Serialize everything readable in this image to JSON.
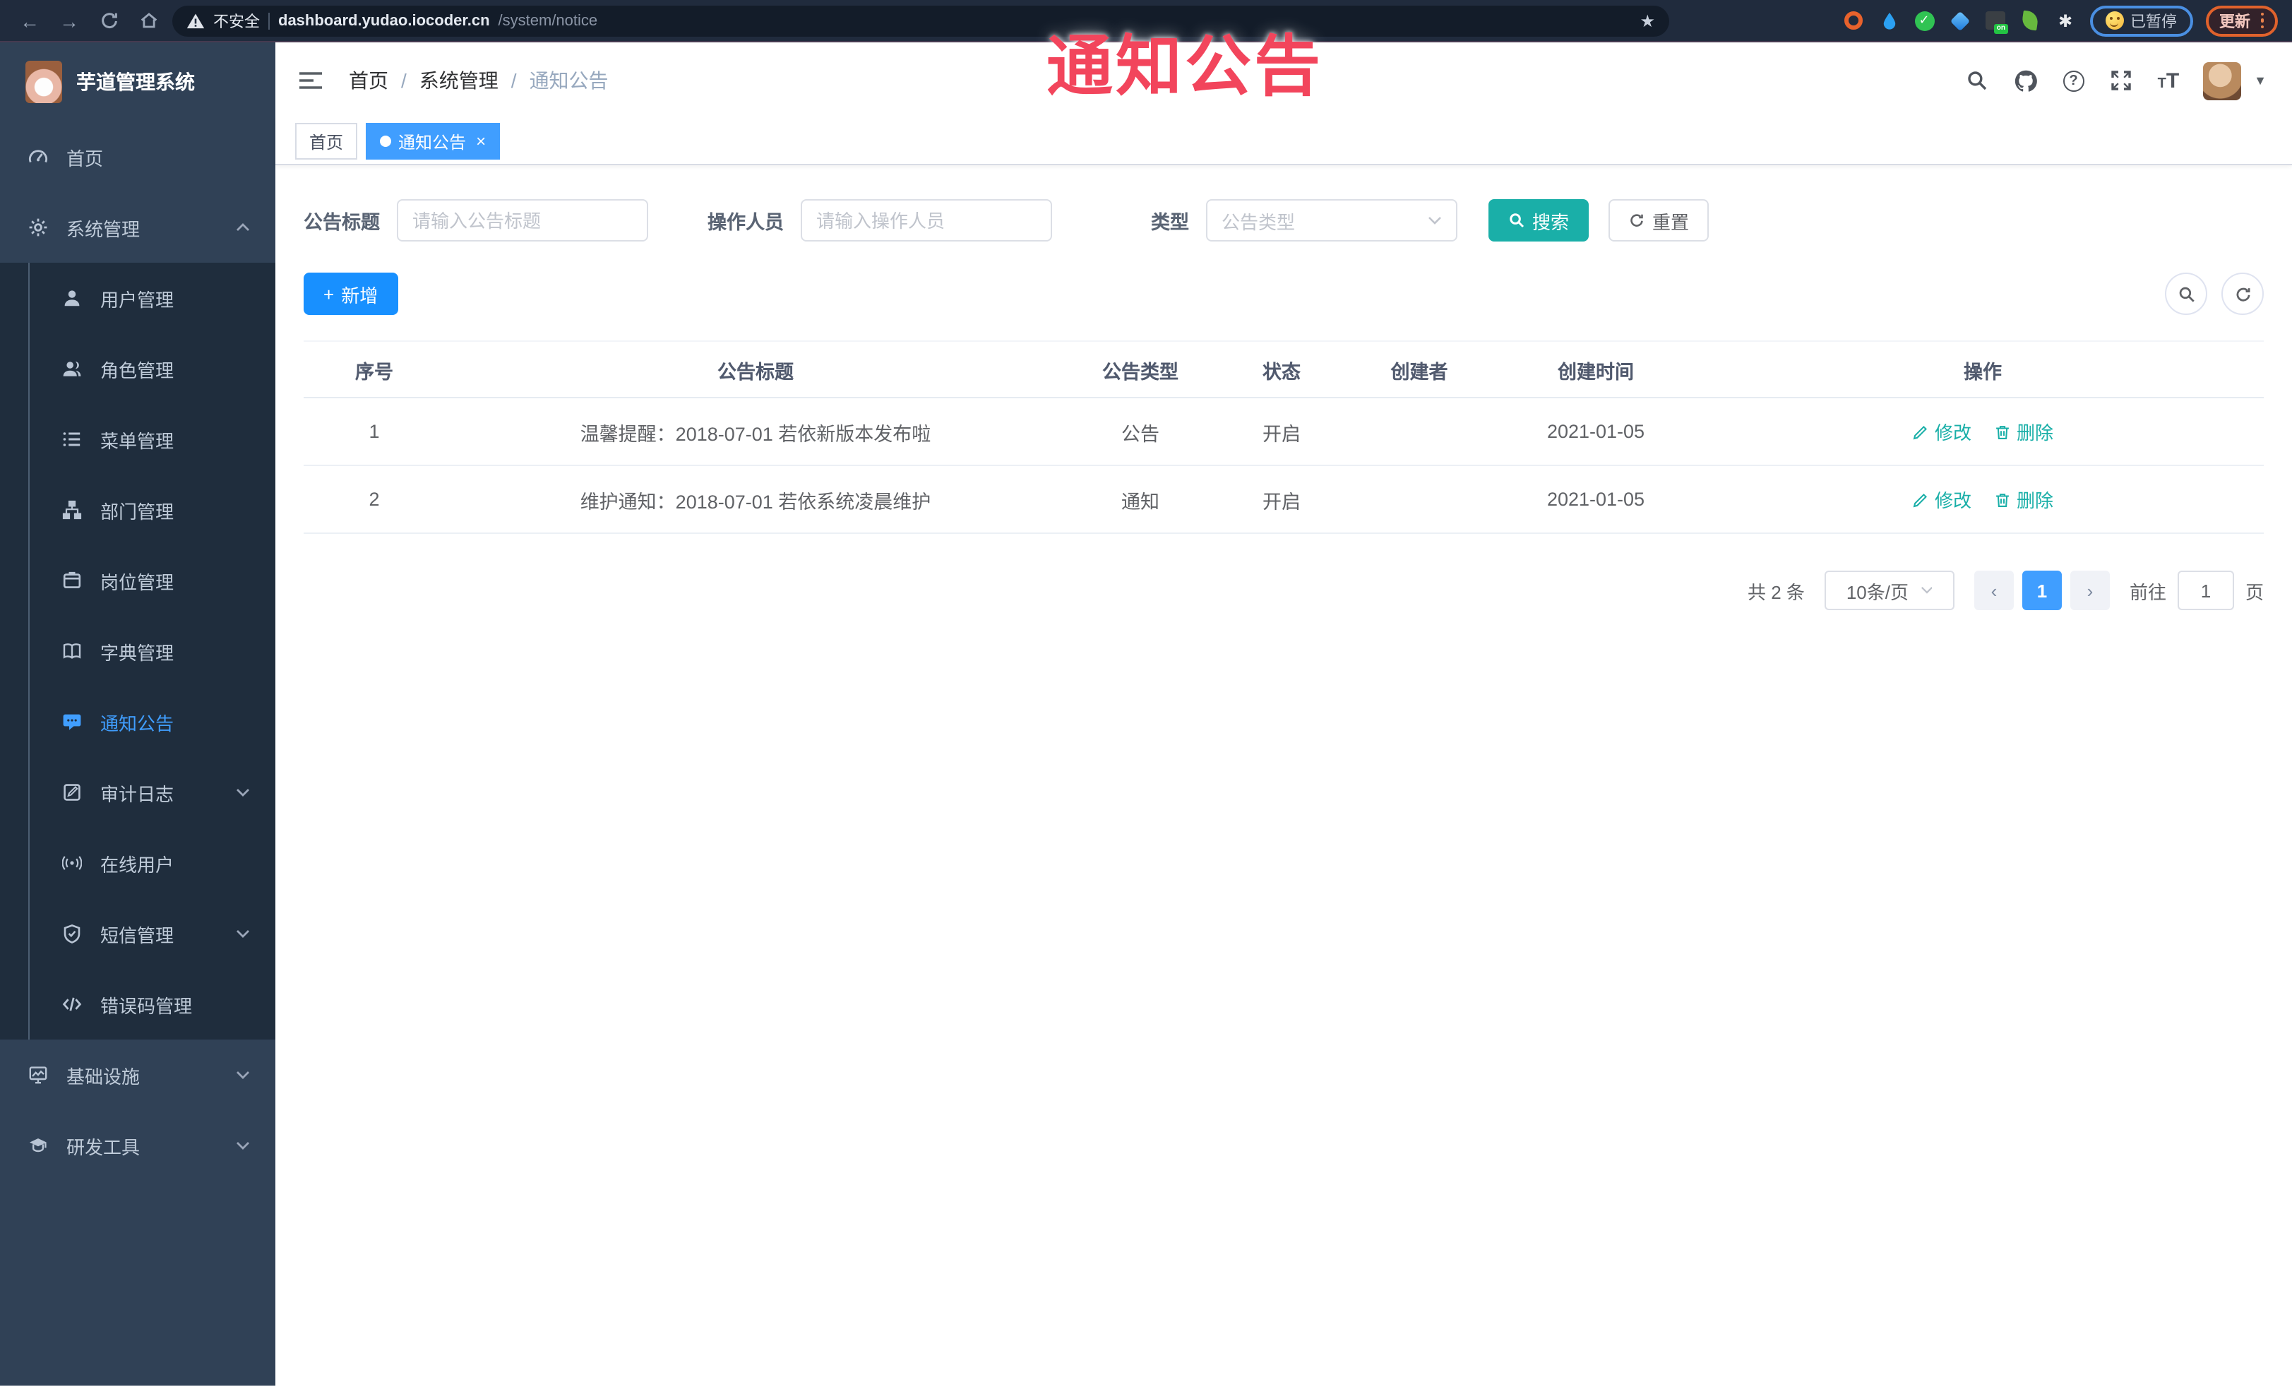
{
  "browser": {
    "security_label": "不安全",
    "url_host": "dashboard.yudao.iocoder.cn",
    "url_path": "/system/notice",
    "extension_on_label": "on",
    "paused_label": "已暂停",
    "update_label": "更新"
  },
  "annotation": {
    "overlay_title": "通知公告"
  },
  "sidebar": {
    "app_title": "芋道管理系统",
    "items": [
      {
        "label": "首页",
        "icon": "dashboard-icon",
        "type": "item"
      },
      {
        "label": "系统管理",
        "icon": "gear-icon",
        "type": "item",
        "arrow": "up"
      },
      {
        "label": "用户管理",
        "icon": "user-icon",
        "type": "sub"
      },
      {
        "label": "角色管理",
        "icon": "users-icon",
        "type": "sub"
      },
      {
        "label": "菜单管理",
        "icon": "menu-list-icon",
        "type": "sub"
      },
      {
        "label": "部门管理",
        "icon": "org-tree-icon",
        "type": "sub"
      },
      {
        "label": "岗位管理",
        "icon": "badge-icon",
        "type": "sub"
      },
      {
        "label": "字典管理",
        "icon": "book-icon",
        "type": "sub"
      },
      {
        "label": "通知公告",
        "icon": "message-icon",
        "type": "sub",
        "active": true
      },
      {
        "label": "审计日志",
        "icon": "log-icon",
        "type": "sub",
        "arrow": "down"
      },
      {
        "label": "在线用户",
        "icon": "online-icon",
        "type": "sub"
      },
      {
        "label": "短信管理",
        "icon": "shield-icon",
        "type": "sub",
        "arrow": "down"
      },
      {
        "label": "错误码管理",
        "icon": "code-icon",
        "type": "sub"
      },
      {
        "label": "基础设施",
        "icon": "monitor-icon",
        "type": "item",
        "arrow": "down"
      },
      {
        "label": "研发工具",
        "icon": "education-icon",
        "type": "item",
        "arrow": "down"
      }
    ]
  },
  "header": {
    "breadcrumb": [
      "首页",
      "系统管理",
      "通知公告"
    ]
  },
  "tags": [
    {
      "label": "首页",
      "active": false
    },
    {
      "label": "通知公告",
      "active": true
    }
  ],
  "filter": {
    "title_label": "公告标题",
    "title_placeholder": "请输入公告标题",
    "operator_label": "操作人员",
    "operator_placeholder": "请输入操作人员",
    "type_label": "类型",
    "type_placeholder": "公告类型",
    "search_label": "搜索",
    "reset_label": "重置"
  },
  "toolbar": {
    "add_label": "新增"
  },
  "table": {
    "columns": [
      "序号",
      "公告标题",
      "公告类型",
      "状态",
      "创建者",
      "创建时间",
      "操作"
    ],
    "rows": [
      {
        "no": "1",
        "title": "温馨提醒：2018-07-01 若依新版本发布啦",
        "type": "公告",
        "status": "开启",
        "creator": "",
        "created": "2021-01-05"
      },
      {
        "no": "2",
        "title": "维护通知：2018-07-01 若依系统凌晨维护",
        "type": "通知",
        "status": "开启",
        "creator": "",
        "created": "2021-01-05"
      }
    ],
    "edit_label": "修改",
    "delete_label": "删除"
  },
  "pagination": {
    "total": "共 2 条",
    "page_size": "10条/页",
    "current": "1",
    "goto_label": "前往",
    "goto_value": "1",
    "page_label": "页"
  },
  "colors": {
    "accent_teal": "#1AAFA8",
    "primary_blue": "#409EFF",
    "add_blue": "#1890FF",
    "overlay_red": "#F2455C",
    "sidebar_bg": "#304156",
    "submenu_bg": "#1F2D3D"
  }
}
